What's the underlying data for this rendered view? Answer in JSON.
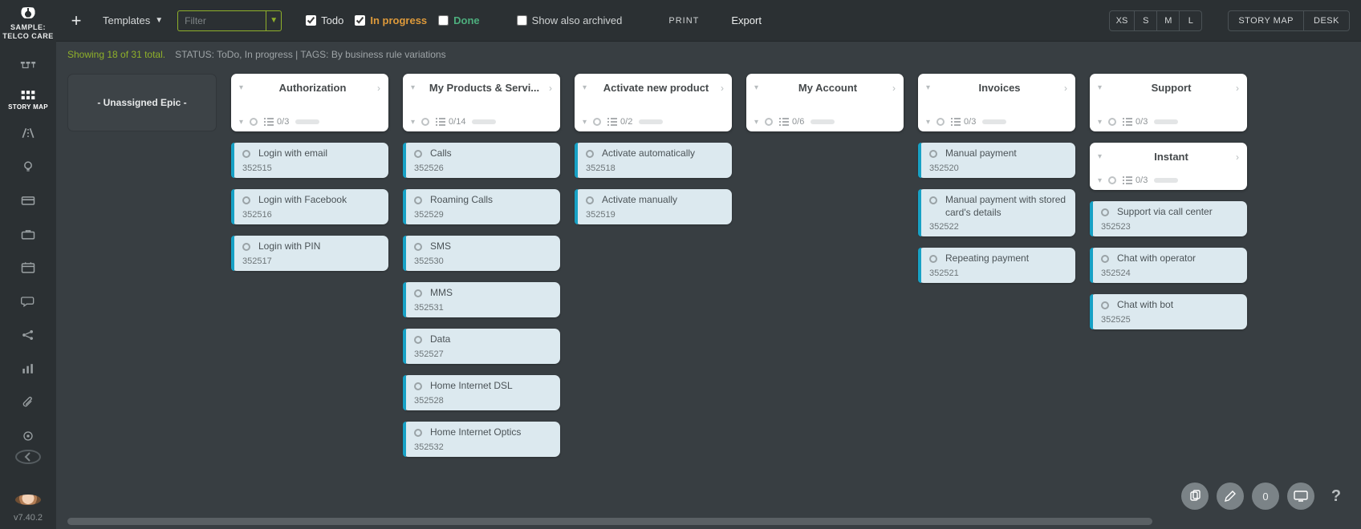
{
  "sidebar": {
    "title_line1": "SAMPLE:",
    "title_line2": "TELCO CARE",
    "items": [
      {
        "name": "dashboard-icon",
        "label": ""
      },
      {
        "name": "story-map-icon",
        "label": "STORY MAP"
      },
      {
        "name": "road-icon",
        "label": ""
      },
      {
        "name": "lightbulb-icon",
        "label": ""
      },
      {
        "name": "calendar-small-icon",
        "label": ""
      },
      {
        "name": "briefcase-icon",
        "label": ""
      },
      {
        "name": "calendar-icon",
        "label": ""
      },
      {
        "name": "chat-icon",
        "label": ""
      },
      {
        "name": "share-icon",
        "label": ""
      },
      {
        "name": "chart-icon",
        "label": ""
      },
      {
        "name": "attachment-icon",
        "label": ""
      },
      {
        "name": "target-icon",
        "label": ""
      }
    ],
    "version": "v7.40.2"
  },
  "toolbar": {
    "templates_label": "Templates",
    "filter_placeholder": "Filter",
    "checks": {
      "todo": "Todo",
      "inprog": "In progress",
      "done": "Done",
      "archived": "Show also archived"
    },
    "checks_state": {
      "todo": true,
      "inprog": true,
      "done": false,
      "archived": false
    },
    "print": "PRINT",
    "export": "Export",
    "sizes": [
      "XS",
      "S",
      "M",
      "L"
    ],
    "views": [
      "STORY MAP",
      "DESK"
    ]
  },
  "status": {
    "count": "Showing 18 of 31 total.",
    "text": "STATUS: ToDo, In progress | TAGS: By business rule variations"
  },
  "board": {
    "unassigned_label": "- Unassigned Epic -",
    "columns": [
      {
        "title": "Authorization",
        "count": "0/3",
        "stories": [
          {
            "id": "352515",
            "title": "Login with email"
          },
          {
            "id": "352516",
            "title": "Login with Facebook"
          },
          {
            "id": "352517",
            "title": "Login with PIN"
          }
        ]
      },
      {
        "title": "My Products & Servi...",
        "count": "0/14",
        "stories": [
          {
            "id": "352526",
            "title": "Calls"
          },
          {
            "id": "352529",
            "title": "Roaming Calls"
          },
          {
            "id": "352530",
            "title": "SMS"
          },
          {
            "id": "352531",
            "title": "MMS"
          },
          {
            "id": "352527",
            "title": "Data"
          },
          {
            "id": "352528",
            "title": "Home Internet DSL"
          },
          {
            "id": "352532",
            "title": "Home Internet Optics"
          }
        ]
      },
      {
        "title": "Activate new product",
        "count": "0/2",
        "stories": [
          {
            "id": "352518",
            "title": "Activate automatically"
          },
          {
            "id": "352519",
            "title": "Activate manually"
          }
        ]
      },
      {
        "title": "My Account",
        "count": "0/6",
        "stories": []
      },
      {
        "title": "Invoices",
        "count": "0/3",
        "stories": [
          {
            "id": "352520",
            "title": "Manual payment"
          },
          {
            "id": "352522",
            "title": "Manual payment with stored card's details"
          },
          {
            "id": "352521",
            "title": "Repeating payment"
          }
        ]
      },
      {
        "title": "Support",
        "count": "0/3",
        "stories": [],
        "subgroup": {
          "title": "Instant",
          "count": "0/3",
          "stories": [
            {
              "id": "352523",
              "title": "Support via call center"
            },
            {
              "id": "352524",
              "title": "Chat with operator"
            },
            {
              "id": "352525",
              "title": "Chat with bot"
            }
          ]
        }
      }
    ]
  },
  "fabs": {
    "count_label": "0"
  }
}
